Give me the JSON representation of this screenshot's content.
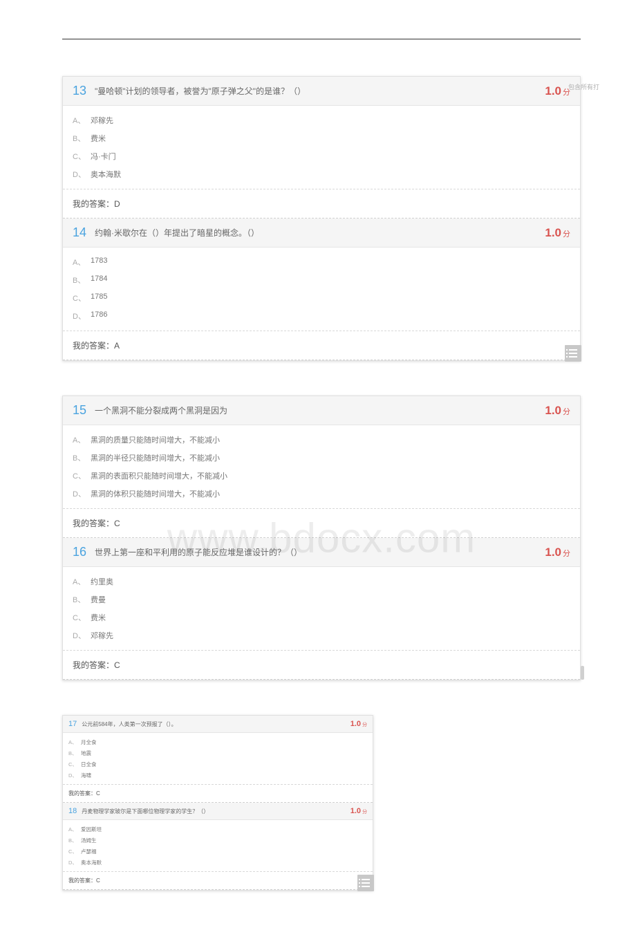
{
  "side_tag": "包含所有打",
  "watermark": "www.bdocx.com",
  "score_unit": "分",
  "answer_prefix": "我的答案：",
  "blocks": [
    {
      "size": "large",
      "has_side_tag": true,
      "has_list_icon": true,
      "has_watermark": false,
      "questions": [
        {
          "number": "13",
          "text": "\"曼哈顿\"计划的领导者，被誉为\"原子弹之父\"的是谁？（）",
          "score": "1.0",
          "options": [
            {
              "label": "A、",
              "text": "邓稼先"
            },
            {
              "label": "B、",
              "text": "费米"
            },
            {
              "label": "C、",
              "text": "冯·卡门"
            },
            {
              "label": "D、",
              "text": "奥本海默"
            }
          ],
          "answer": "D"
        },
        {
          "number": "14",
          "text": "约翰·米歇尔在（）年提出了暗星的概念。（）",
          "score": "1.0",
          "options": [
            {
              "label": "A、",
              "text": "1783"
            },
            {
              "label": "B、",
              "text": "1784"
            },
            {
              "label": "C、",
              "text": "1785"
            },
            {
              "label": "D、",
              "text": "1786"
            }
          ],
          "answer": "A"
        }
      ]
    },
    {
      "size": "large",
      "has_side_tag": false,
      "has_list_icon": false,
      "has_scroll_hint": true,
      "has_watermark": true,
      "questions": [
        {
          "number": "15",
          "text": "一个黑洞不能分裂成两个黑洞是因为",
          "score": "1.0",
          "options": [
            {
              "label": "A、",
              "text": "黑洞的质量只能随时间增大，不能减小"
            },
            {
              "label": "B、",
              "text": "黑洞的半径只能随时间增大，不能减小"
            },
            {
              "label": "C、",
              "text": "黑洞的表面积只能随时间增大，不能减小"
            },
            {
              "label": "D、",
              "text": "黑洞的体积只能随时间增大，不能减小"
            }
          ],
          "answer": "C"
        },
        {
          "number": "16",
          "text": "世界上第一座和平利用的原子能反应堆是谁设计的？（）",
          "score": "1.0",
          "options": [
            {
              "label": "A、",
              "text": "约里奥"
            },
            {
              "label": "B、",
              "text": "费曼"
            },
            {
              "label": "C、",
              "text": "费米"
            },
            {
              "label": "D、",
              "text": "邓稼先"
            }
          ],
          "answer": "C"
        }
      ]
    },
    {
      "size": "small",
      "has_side_tag": false,
      "has_list_icon": true,
      "has_watermark": false,
      "questions": [
        {
          "number": "17",
          "text": "公元前584年，人类第一次预报了（）。",
          "score": "1.0",
          "options": [
            {
              "label": "A、",
              "text": "月全食"
            },
            {
              "label": "B、",
              "text": "地震"
            },
            {
              "label": "C、",
              "text": "日全食"
            },
            {
              "label": "D、",
              "text": "海啸"
            }
          ],
          "answer": "C"
        },
        {
          "number": "18",
          "text": "丹麦物理学家玻尔是下面哪位物理学家的学生？（）",
          "score": "1.0",
          "options": [
            {
              "label": "A、",
              "text": "爱因斯坦"
            },
            {
              "label": "B、",
              "text": "汤姆生"
            },
            {
              "label": "C、",
              "text": "卢瑟福"
            },
            {
              "label": "D、",
              "text": "奥本海默"
            }
          ],
          "answer": "C"
        }
      ]
    }
  ]
}
